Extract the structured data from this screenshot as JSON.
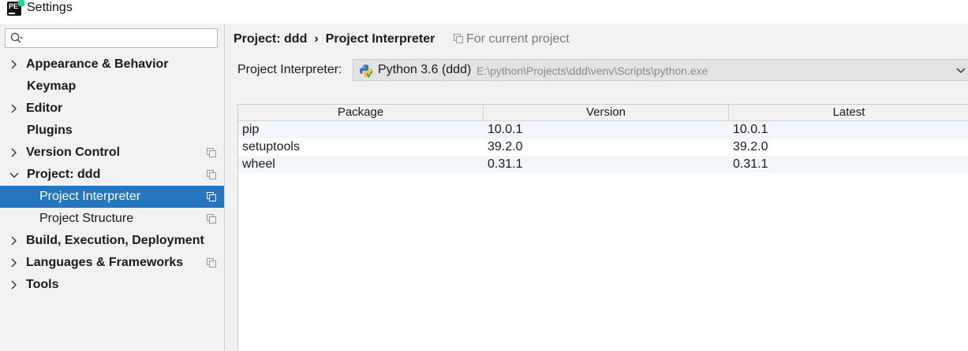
{
  "window": {
    "title": "Settings"
  },
  "sidebar": {
    "search_placeholder": "",
    "items": [
      {
        "label": "Appearance & Behavior"
      },
      {
        "label": "Keymap"
      },
      {
        "label": "Editor"
      },
      {
        "label": "Plugins"
      },
      {
        "label": "Version Control"
      },
      {
        "label": "Project: ddd"
      },
      {
        "label": "Project Interpreter"
      },
      {
        "label": "Project Structure"
      },
      {
        "label": "Build, Execution, Deployment"
      },
      {
        "label": "Languages & Frameworks"
      },
      {
        "label": "Tools"
      }
    ]
  },
  "main": {
    "breadcrumb": {
      "parent": "Project: ddd",
      "separator": "›",
      "current": "Project Interpreter"
    },
    "scope_label": "For current project",
    "interpreter": {
      "label": "Project Interpreter:",
      "name": "Python 3.6 (ddd)",
      "path": "E:\\python\\Projects\\ddd\\venv\\Scripts\\python.exe"
    },
    "packages": {
      "columns": [
        "Package",
        "Version",
        "Latest"
      ],
      "rows": [
        {
          "package": "pip",
          "version": "10.0.1",
          "latest": "10.0.1"
        },
        {
          "package": "setuptools",
          "version": "39.2.0",
          "latest": "39.2.0"
        },
        {
          "package": "wheel",
          "version": "0.31.1",
          "latest": "0.31.1"
        }
      ]
    }
  },
  "colors": {
    "selection": "#2675bf",
    "background": "#f2f2f2",
    "python_blue": "#3a75b0",
    "python_yellow": "#f5c53c"
  }
}
